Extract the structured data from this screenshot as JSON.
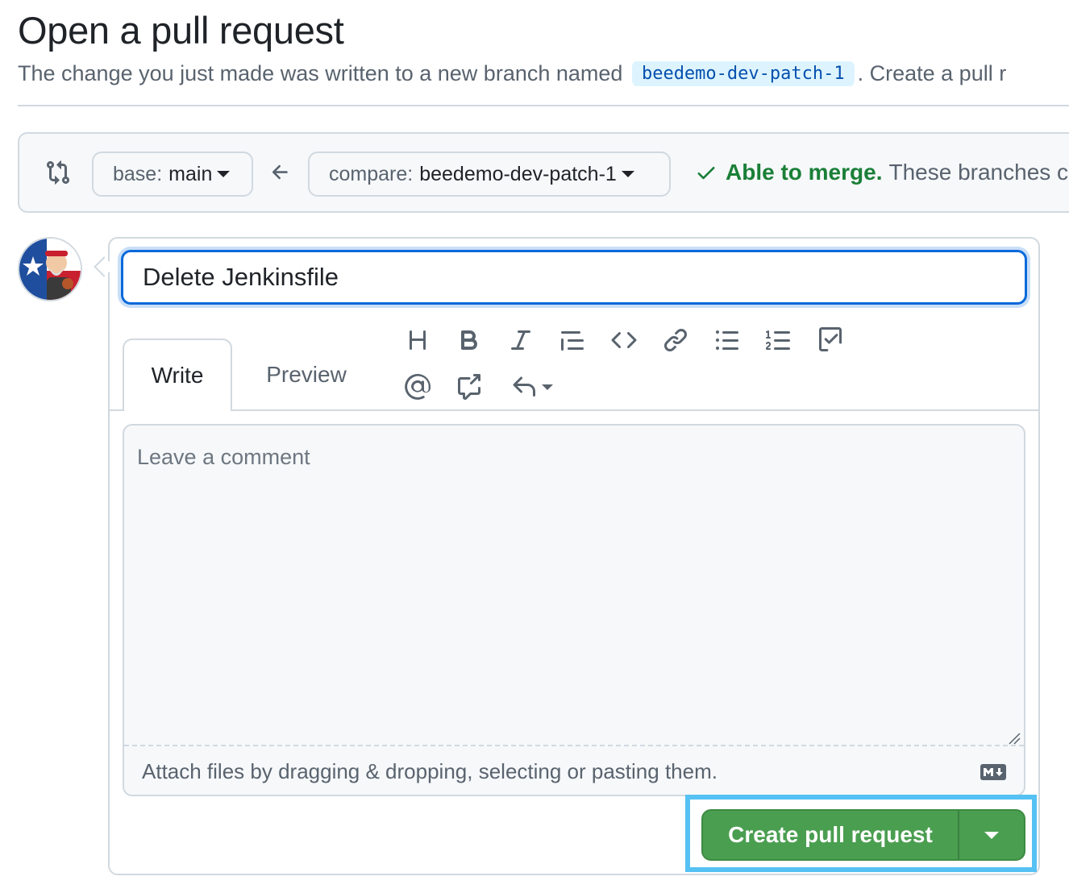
{
  "header": {
    "title": "Open a pull request",
    "subtitle_before": "The change you just made was written to a new branch named",
    "branch_name": "beedemo-dev-patch-1",
    "subtitle_after": ". Create a pull r"
  },
  "compare": {
    "base_prefix": "base:",
    "base_value": "main",
    "compare_prefix": "compare:",
    "compare_value": "beedemo-dev-patch-1",
    "merge_status": "Able to merge.",
    "merge_description": "These branches c",
    "status_color": "#1a7f37"
  },
  "form": {
    "title_value": "Delete Jenkinsfile",
    "tabs": [
      {
        "label": "Write",
        "active": true
      },
      {
        "label": "Preview",
        "active": false
      }
    ],
    "toolbar_icons": [
      "heading-icon",
      "bold-icon",
      "italic-icon",
      "quote-icon",
      "code-icon",
      "link-icon",
      "unordered-list-icon",
      "ordered-list-icon",
      "task-list-icon",
      "mention-icon",
      "cross-reference-icon",
      "saved-replies-icon"
    ],
    "comment_placeholder": "Leave a comment",
    "attach_hint": "Attach files by dragging & dropping, selecting or pasting them.",
    "markdown_icon": "markdown-icon"
  },
  "actions": {
    "create_label": "Create pull request",
    "button_color": "#4a9e50",
    "highlight_color": "#56c1f3"
  }
}
